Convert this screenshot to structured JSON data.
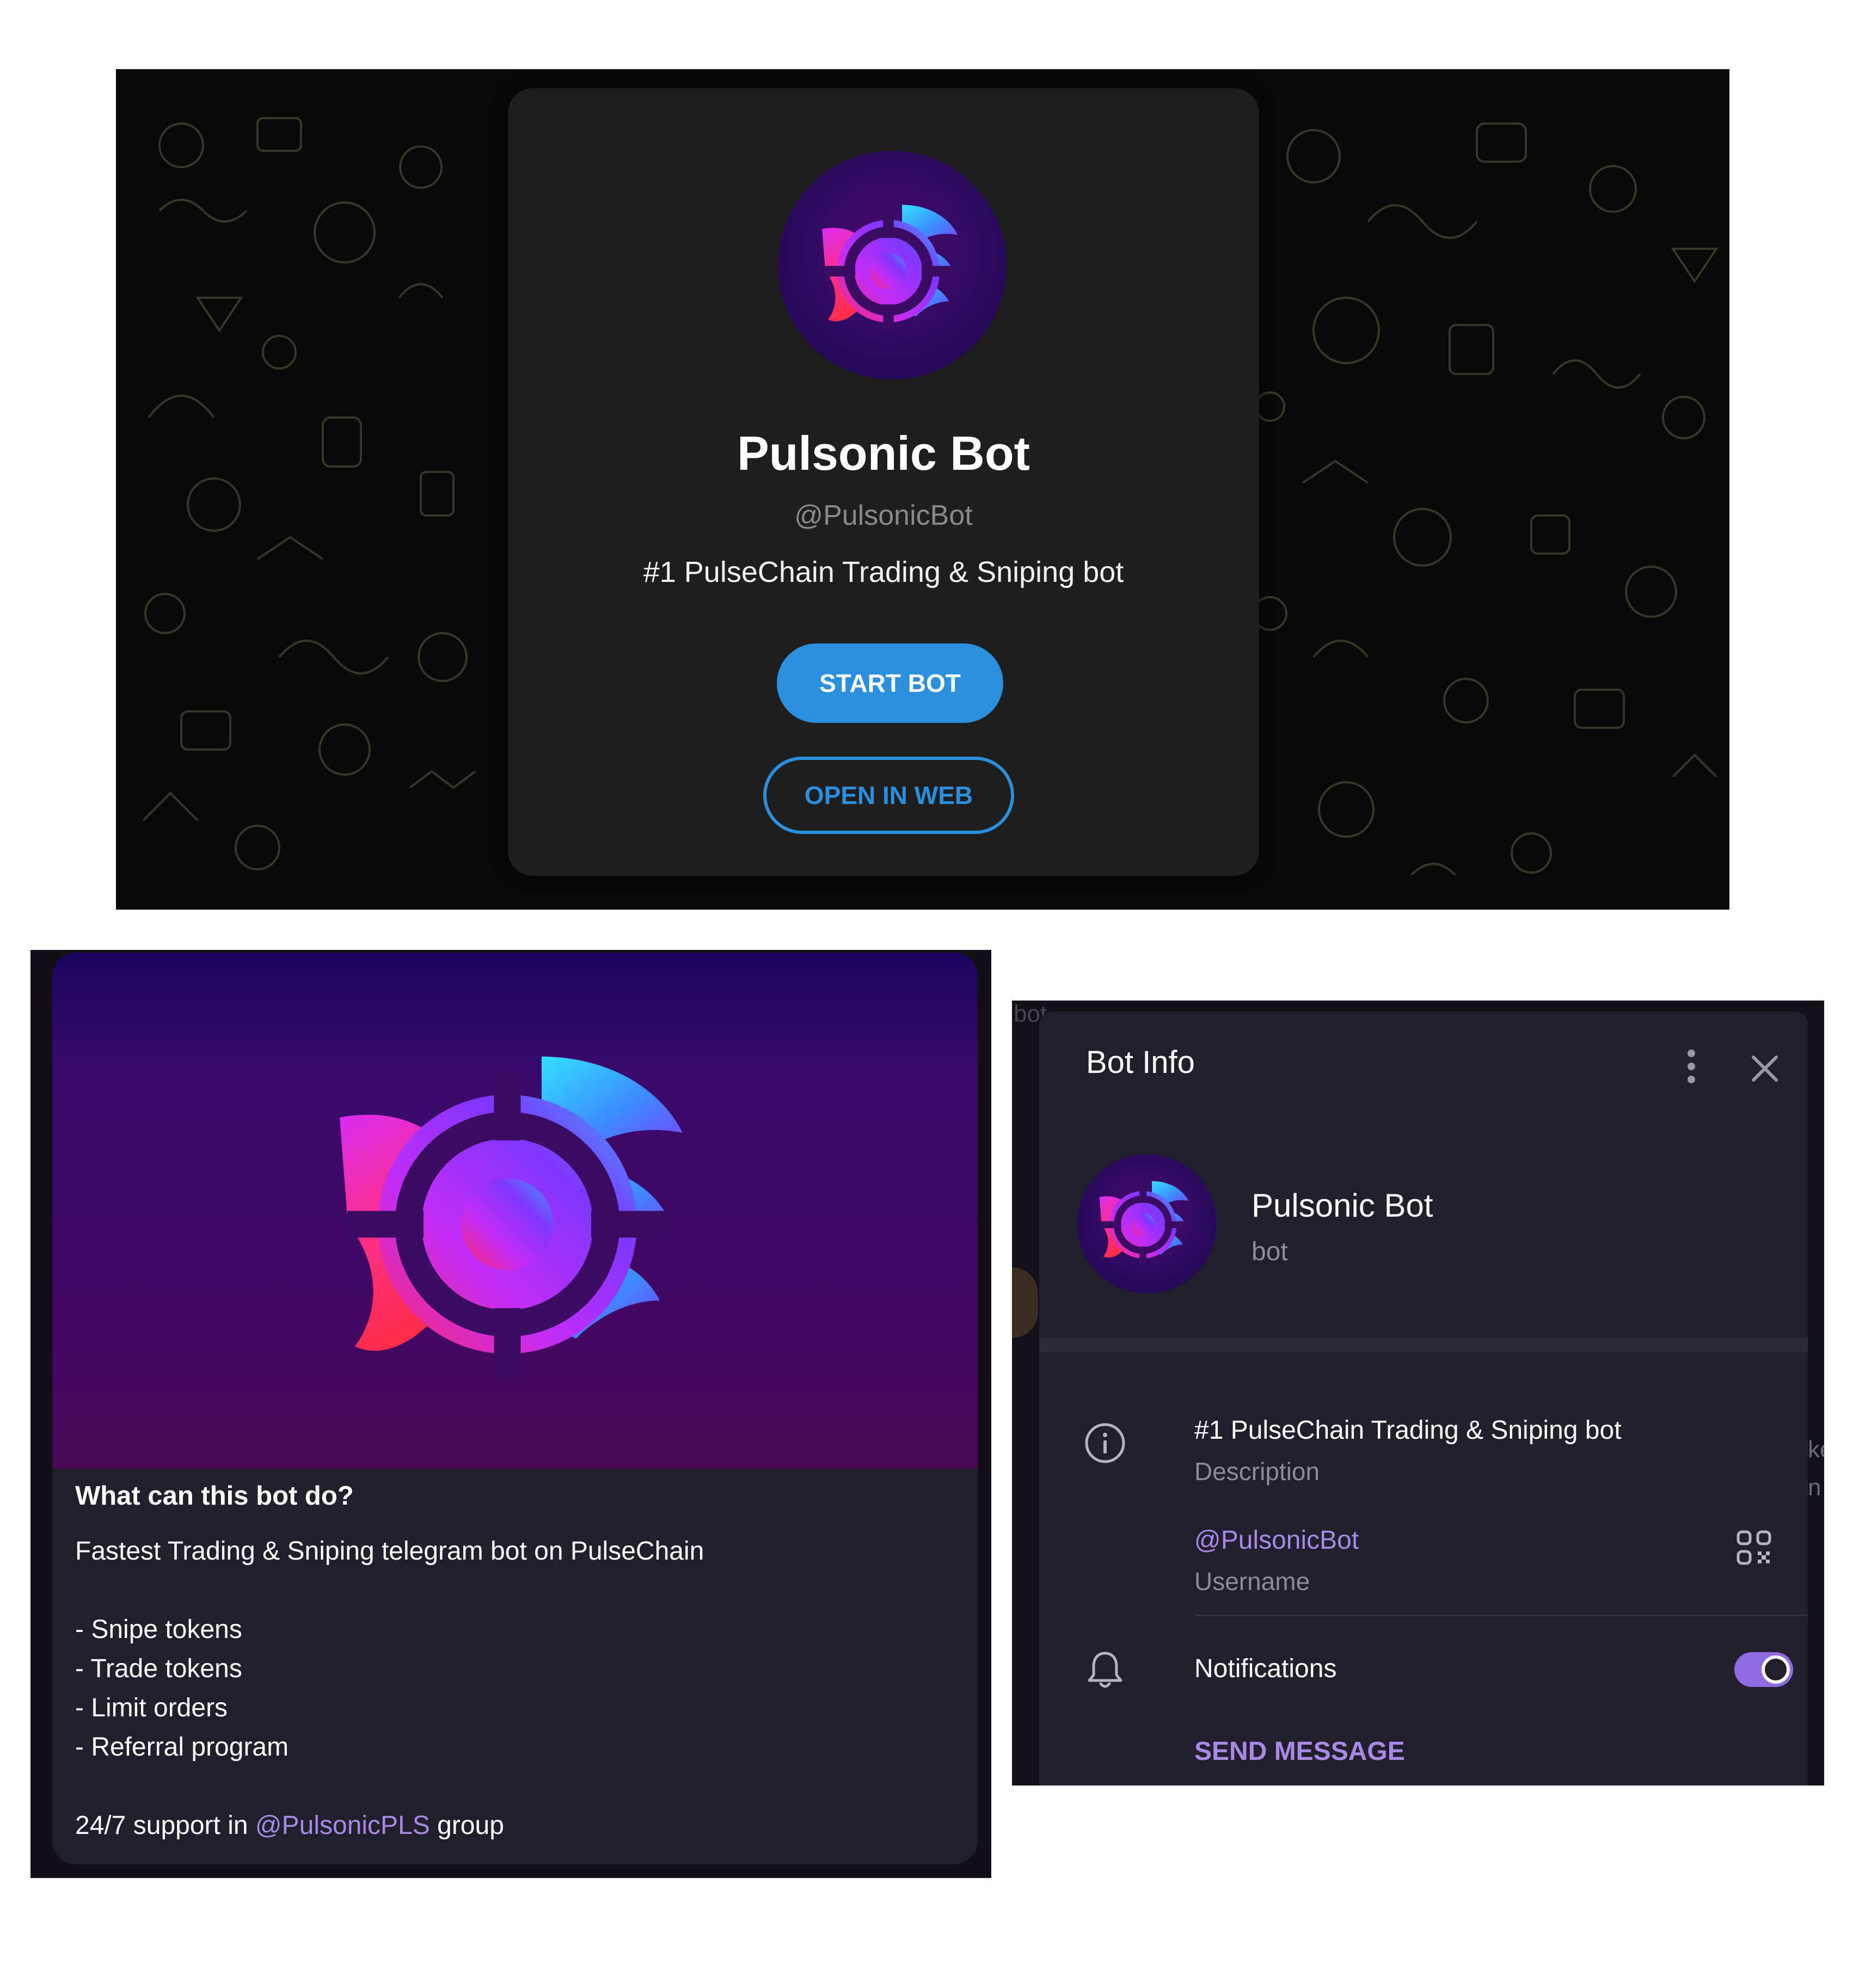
{
  "preview": {
    "title": "Pulsonic Bot",
    "handle": "@PulsonicBot",
    "tagline": "#1 PulseChain Trading & Sniping bot",
    "start_button": "START BOT",
    "open_web_button": "OPEN IN WEB",
    "accent_color": "#2a8fdd"
  },
  "intro_card": {
    "heading": "What can this bot do?",
    "summary": "Fastest Trading & Sniping telegram bot on PulseChain",
    "features": [
      "- Snipe tokens",
      "- Trade tokens",
      "- Limit orders",
      "- Referral program"
    ],
    "support_prefix": "24/7 support in ",
    "support_link": "@PulsonicPLS",
    "support_suffix": " group"
  },
  "bot_info": {
    "header_title": "Bot Info",
    "name": "Pulsonic Bot",
    "kind": "bot",
    "description_value": "#1 PulseChain Trading & Sniping bot",
    "description_label": "Description",
    "username_value": "@PulsonicBot",
    "username_label": "Username",
    "notifications_label": "Notifications",
    "notifications_enabled": true,
    "send_message": "SEND MESSAGE",
    "peek_text": "bot",
    "edge_letters": [
      "ke",
      "n"
    ],
    "accent_color": "#a889e6"
  },
  "icons": [
    "more-vertical-icon",
    "close-icon",
    "info-icon",
    "qr-code-icon",
    "bell-icon"
  ]
}
